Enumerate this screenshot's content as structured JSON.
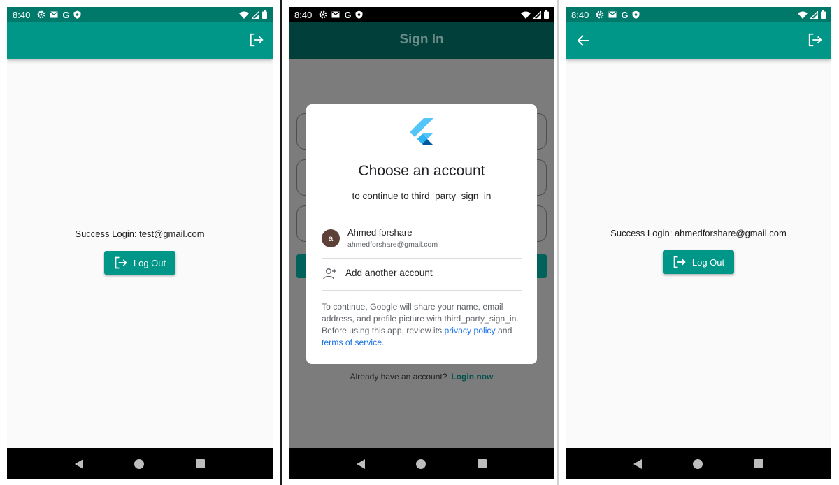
{
  "status_bar": {
    "time": "8:40",
    "left_icons": [
      "settings-icon",
      "mail-icon",
      "google-g-icon",
      "shield-icon"
    ],
    "right_icons": [
      "wifi-icon",
      "signal-icon",
      "battery-icon"
    ]
  },
  "screen1": {
    "success_text": "Success Login: test@gmail.com",
    "logout_label": "Log Out"
  },
  "screen2": {
    "title": "Sign In",
    "already_text": "Already have an account?",
    "login_now": "Login now",
    "dialog": {
      "title": "Choose an account",
      "subtitle": "to continue to third_party_sign_in",
      "account": {
        "initial": "a",
        "name": "Ahmed forshare",
        "email": "ahmedforshare@gmail.com"
      },
      "add_account_label": "Add another account",
      "disclaimer_1": "To continue, Google will share your name, email address, and profile picture with third_party_sign_in. Before using this app, review its",
      "privacy_link": "privacy policy",
      "and_text": "and",
      "terms_link": "terms of service",
      "period": "."
    }
  },
  "screen3": {
    "success_text": "Success Login: ahmedforshare@gmail.com",
    "logout_label": "Log Out"
  },
  "colors": {
    "primary": "#009688",
    "status_bar": "#00796b",
    "link": "#1a73e8"
  }
}
